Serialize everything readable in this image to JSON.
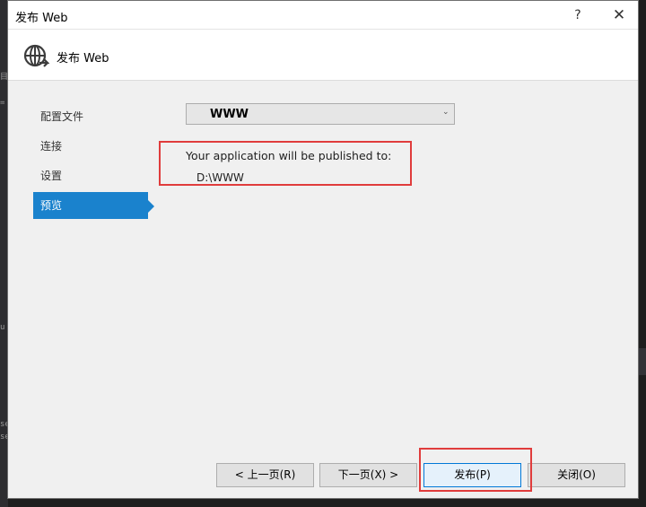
{
  "window": {
    "title": "发布 Web",
    "help_label": "?",
    "close_label": "✕"
  },
  "header": {
    "title": "发布 Web",
    "icon": "globe-publish-icon"
  },
  "nav": {
    "items": [
      {
        "label": "配置文件",
        "active": false
      },
      {
        "label": "连接",
        "active": false
      },
      {
        "label": "设置",
        "active": false
      },
      {
        "label": "预览",
        "active": true
      }
    ]
  },
  "profile_select": {
    "value": "WWW",
    "chevron": "⌄"
  },
  "preview": {
    "description": "Your application will be published to:",
    "path": "D:\\WWW"
  },
  "footer": {
    "prev_label": "< 上一页(R)",
    "next_label": "下一页(X) >",
    "publish_label": "发布(P)",
    "close_label": "关闭(O)"
  },
  "colors": {
    "accent": "#1a82cd",
    "highlight": "#e03c3c",
    "dialog_bg": "#f0f0f0"
  }
}
